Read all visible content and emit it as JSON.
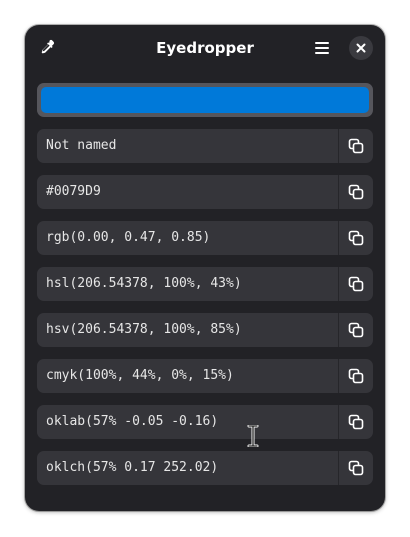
{
  "window": {
    "title": "Eyedropper"
  },
  "header": {
    "picker_icon": "eyedropper-icon",
    "menu_icon": "hamburger-menu-icon",
    "close_icon": "close-icon"
  },
  "swatch": {
    "color": "#0079D9"
  },
  "formats": [
    {
      "label": "Not named"
    },
    {
      "label": "#0079D9"
    },
    {
      "label": "rgb(0.00, 0.47, 0.85)"
    },
    {
      "label": "hsl(206.54378, 100%, 43%)"
    },
    {
      "label": "hsv(206.54378, 100%, 85%)"
    },
    {
      "label": "cmyk(100%, 44%, 0%, 15%)"
    },
    {
      "label": "oklab(57% -0.05 -0.16)"
    },
    {
      "label": "oklch(57% 0.17 252.02)"
    }
  ],
  "copy_icon": "copy-icon",
  "colors": {
    "window_bg": "#222226",
    "row_bg": "#35353a",
    "text": "#e6e6e6",
    "accent": "#0079D9"
  }
}
